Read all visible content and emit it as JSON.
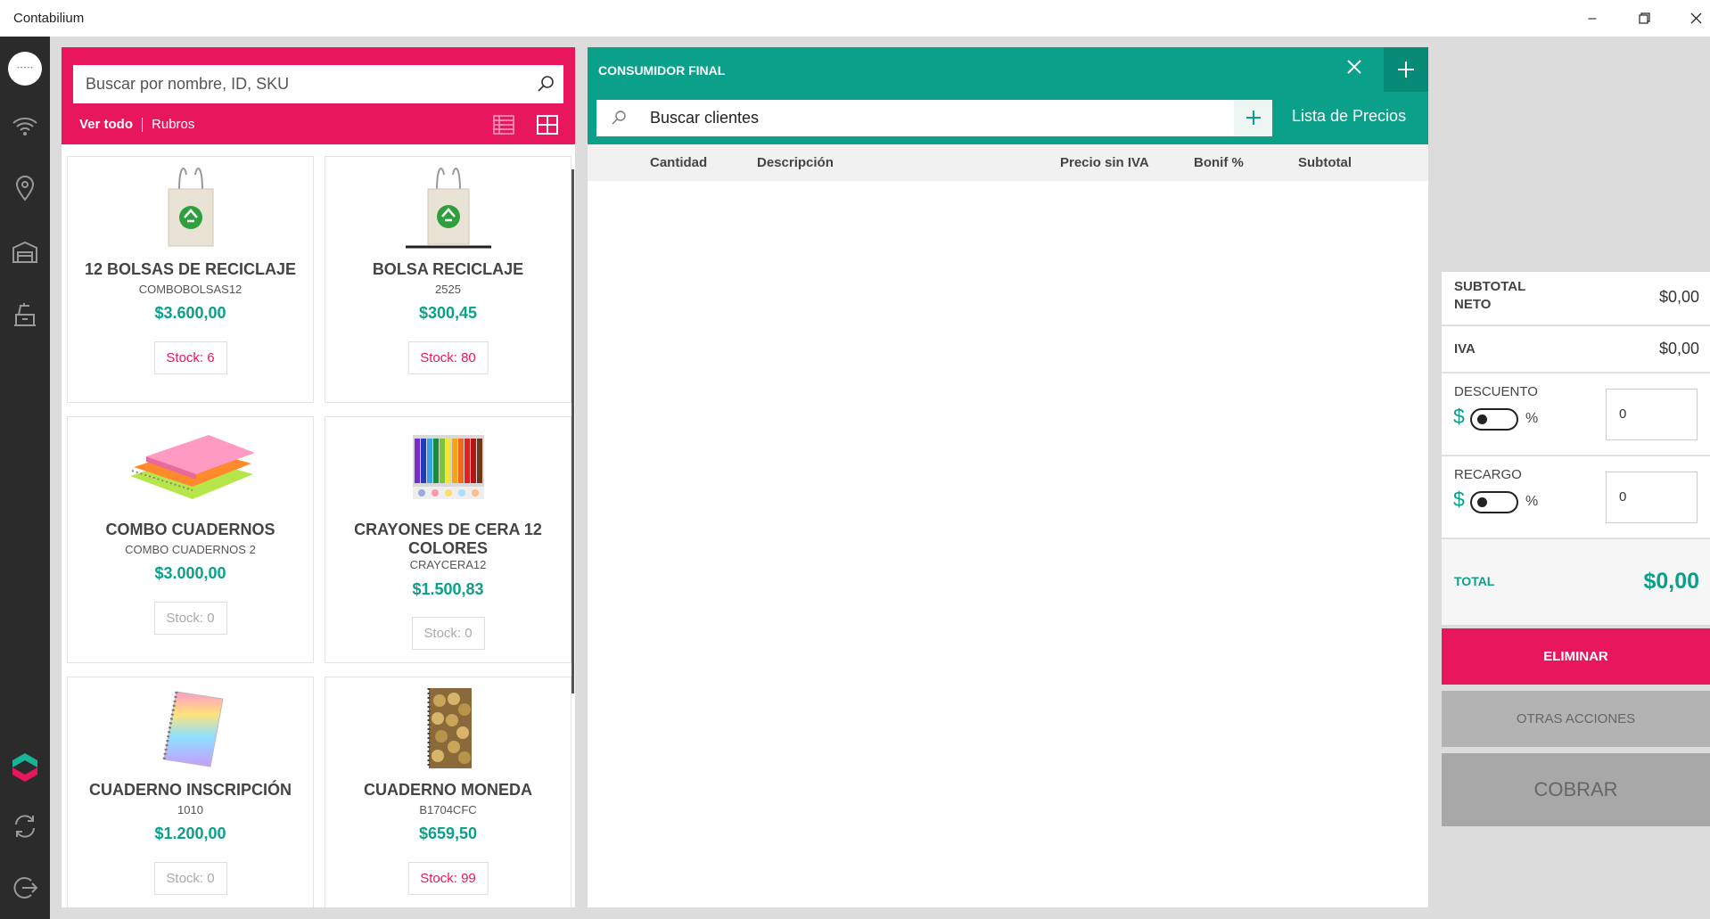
{
  "app": {
    "title": "Contabilium"
  },
  "catalog": {
    "search_placeholder": "Buscar por nombre, ID, SKU",
    "filter_all": "Ver todo",
    "filter_rubros": "Rubros",
    "products": [
      {
        "name": "12 BOLSAS DE RECICLAJE",
        "sku": "COMBOBOLSAS12",
        "price": "$3.600,00",
        "stock": "Stock: 6",
        "icon": "tote-bag-icon"
      },
      {
        "name": "BOLSA RECICLAJE",
        "sku": "2525",
        "price": "$300,45",
        "stock": "Stock: 80",
        "icon": "tote-bag-icon"
      },
      {
        "name": "COMBO CUADERNOS",
        "sku": "COMBO CUADERNOS 2",
        "price": "$3.000,00",
        "stock": "Stock: 0",
        "icon": "notebooks-icon"
      },
      {
        "name": "CRAYONES DE CERA 12 COLORES",
        "sku": "CRAYCERA12",
        "price": "$1.500,83",
        "stock": "Stock: 0",
        "icon": "crayons-icon"
      },
      {
        "name": "CUADERNO INSCRIPCIÓN",
        "sku": "1010",
        "price": "$1.200,00",
        "stock": "Stock: 0",
        "icon": "notebook-icon"
      },
      {
        "name": "CUADERNO MONEDA",
        "sku": "B1704CFC",
        "price": "$659,50",
        "stock": "Stock: 99",
        "icon": "coin-notebook-icon"
      }
    ]
  },
  "order": {
    "customer": "CONSUMIDOR FINAL",
    "client_search_placeholder": "Buscar clientes",
    "price_list": "Lista de Precios",
    "columns": [
      "Cantidad",
      "Descripción",
      "Precio sin IVA",
      "Bonif %",
      "Subtotal"
    ]
  },
  "summary": {
    "subtotal_label_1": "SUBTOTAL",
    "subtotal_label_2": "NETO",
    "subtotal_value": "$0,00",
    "iva_label": "IVA",
    "iva_value": "$0,00",
    "descuento_label": "DESCUENTO",
    "descuento_value": "0",
    "recargo_label": "RECARGO",
    "recargo_value": "0",
    "currency_symbol": "$",
    "percent_symbol": "%",
    "total_label": "TOTAL",
    "total_value": "$0,00"
  },
  "actions": {
    "eliminar": "ELIMINAR",
    "otras": "OTRAS ACCIONES",
    "cobrar": "COBRAR"
  },
  "colors": {
    "brand_pink": "#e8175d",
    "brand_teal": "#0aa08a"
  }
}
